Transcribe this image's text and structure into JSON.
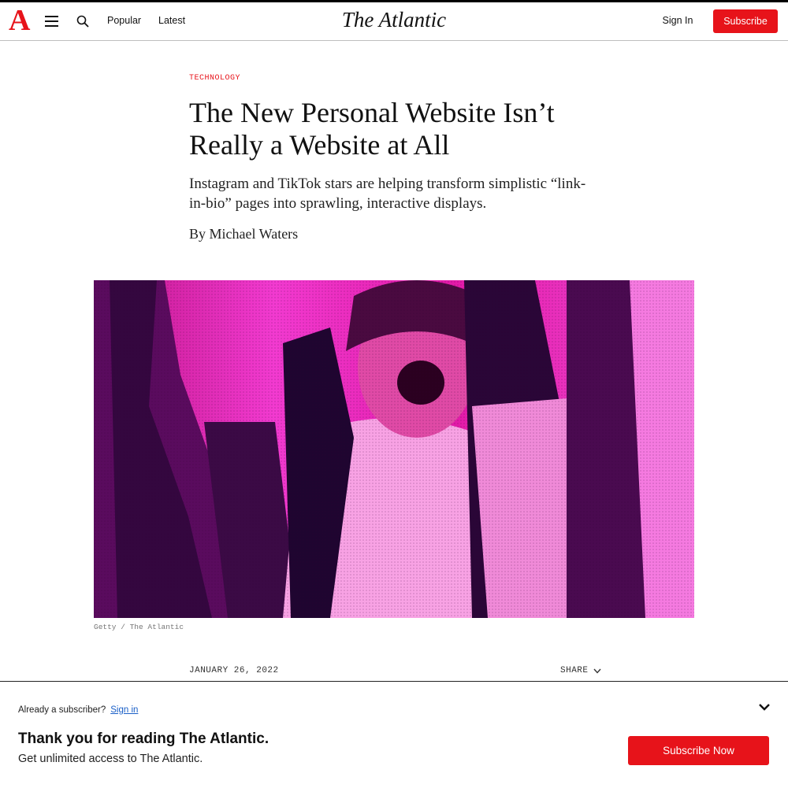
{
  "header": {
    "logo_letter": "A",
    "nav": {
      "popular": "Popular",
      "latest": "Latest"
    },
    "wordmark": "The Atlantic",
    "sign_in": "Sign In",
    "subscribe": "Subscribe",
    "icons": [
      "menu-icon",
      "search-icon"
    ]
  },
  "article": {
    "section": "TECHNOLOGY",
    "headline": "The New Personal Website Isn’t Really a Website at All",
    "dek": "Instagram and TikTok stars are helping transform simplistic “link-in-bio” pages into sprawling, interactive displays.",
    "byline": "By Michael Waters",
    "image_caption": "Getty / The Atlantic",
    "date": "JANUARY 26, 2022",
    "share": "SHARE"
  },
  "banner": {
    "already_subscriber": "Already a subscriber?",
    "sign_in_link": "Sign in",
    "title": "Thank you for reading The Atlantic.",
    "subtitle": "Get unlimited access to The Atlantic.",
    "cta": "Subscribe Now"
  },
  "colors": {
    "brand_red": "#e7131a",
    "link_blue": "#1a5fc7",
    "image_magenta": "#e21aa8"
  }
}
